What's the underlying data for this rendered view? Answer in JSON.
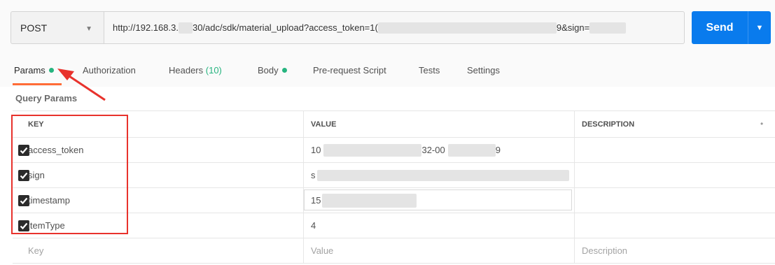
{
  "request": {
    "method": "POST",
    "url_visible": [
      "http://192.168.3.",
      "30/adc/sdk/material_upload?access_token=1(",
      "9&sign="
    ],
    "send_label": "Send"
  },
  "tabs": [
    {
      "label": "Params",
      "dot": true,
      "active": true
    },
    {
      "label": "Authorization"
    },
    {
      "label": "Headers",
      "count": "(10)"
    },
    {
      "label": "Body",
      "dot": true
    },
    {
      "label": "Pre-request Script"
    },
    {
      "label": "Tests"
    },
    {
      "label": "Settings"
    }
  ],
  "query_params": {
    "title": "Query Params",
    "columns": {
      "key": "KEY",
      "value": "VALUE",
      "description": "DESCRIPTION"
    },
    "rows": [
      {
        "key": "access_token",
        "value_visible": "10",
        "value_tail": "32-00",
        "value_end": "9",
        "checked": true
      },
      {
        "key": "sign",
        "value_visible": "s",
        "checked": true
      },
      {
        "key": "timestamp",
        "value_visible": "15",
        "checked": true
      },
      {
        "key": "itemType",
        "value_visible": "4",
        "checked": true
      }
    ],
    "placeholder": {
      "key": "Key",
      "value": "Value",
      "description": "Description"
    }
  },
  "colors": {
    "accent": "#097bed",
    "status_dot": "#26b47f",
    "tab_underline": "#ff6c37",
    "annotation": "#e8322c"
  }
}
